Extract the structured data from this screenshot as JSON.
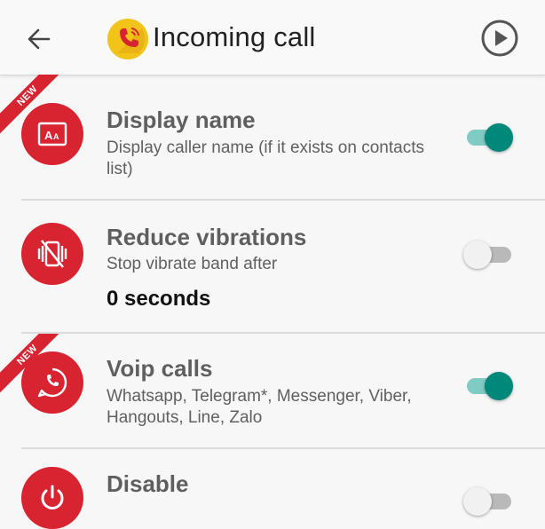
{
  "header": {
    "title": "Incoming call",
    "back_icon": "arrow-back-icon",
    "logo_icon": "phone-ringing-logo-icon",
    "play_icon": "play-circle-icon"
  },
  "colors": {
    "accent_red": "#d82330",
    "toggle_on": "#00897b",
    "toggle_on_track": "#80cbc4",
    "toggle_off_track": "#b9b9b9"
  },
  "settings": [
    {
      "badge": "NEW",
      "icon": "display-name-icon",
      "title": "Display name",
      "description": "Display caller name (if it exists on contacts list)",
      "enabled": true
    },
    {
      "icon": "vibration-off-icon",
      "title": "Reduce vibrations",
      "description": "Stop vibrate band after",
      "value": "0 seconds",
      "enabled": false
    },
    {
      "badge": "NEW",
      "icon": "voip-call-icon",
      "title": "Voip calls",
      "description": "Whatsapp, Telegram*, Messenger, Viber, Hangouts, Line, Zalo",
      "enabled": true
    },
    {
      "icon": "power-icon",
      "title": "Disable",
      "enabled": false
    }
  ]
}
